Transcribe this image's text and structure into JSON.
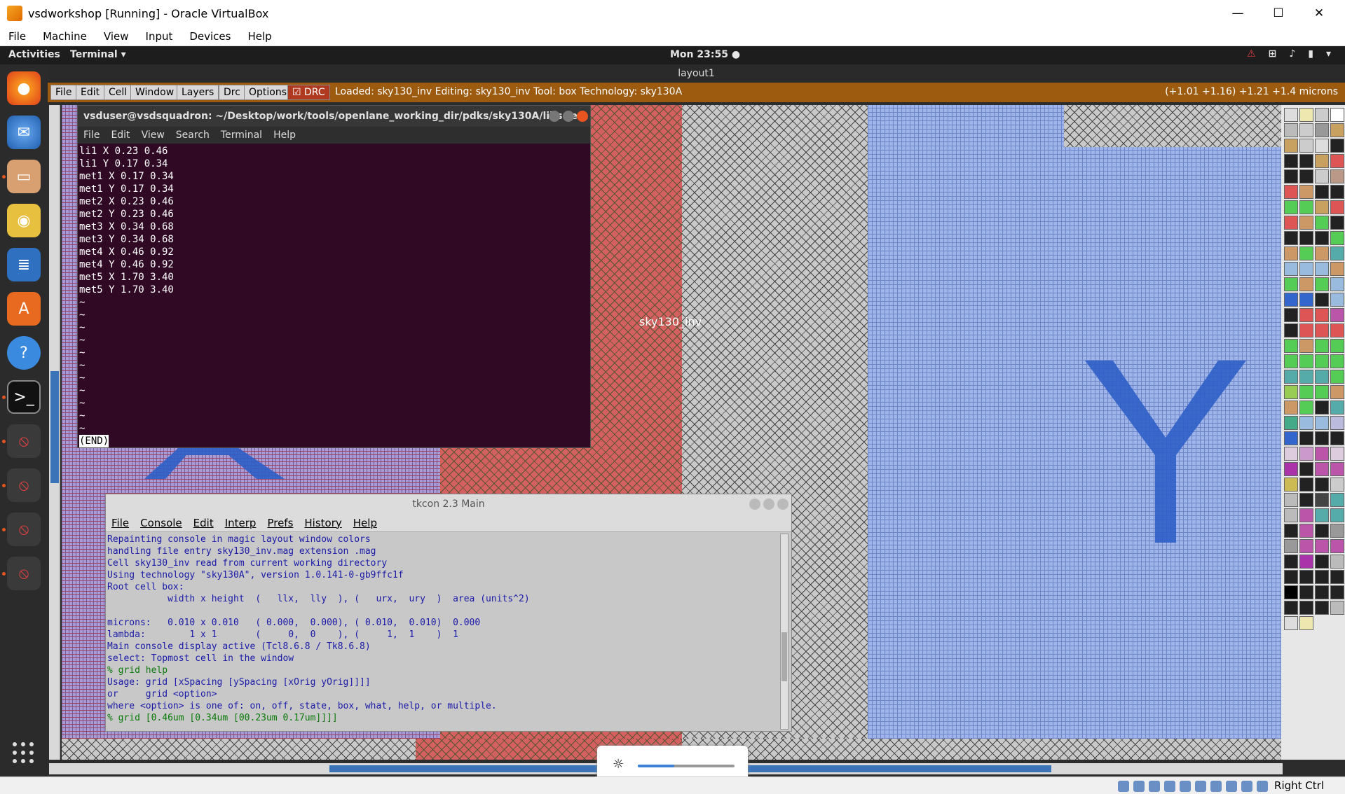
{
  "vbox": {
    "title": "vsdworkshop  [Running] - Oracle VirtualBox",
    "menu": [
      "File",
      "Machine",
      "View",
      "Input",
      "Devices",
      "Help"
    ],
    "status_right": "Right Ctrl"
  },
  "topbar": {
    "activities": "Activities",
    "app": "Terminal ▾",
    "clock": "Mon 23:55 ●"
  },
  "magic": {
    "window_title": "layout1",
    "menu": [
      "File",
      "Edit",
      "Cell",
      "Window",
      "Layers",
      "Drc",
      "Options"
    ],
    "drc_label": "DRC",
    "status": "Loaded: sky130_inv Editing: sky130_inv Tool: box  Technology: sky130A",
    "coords": "(+1.01 +1.16) +1.21 +1.4 microns",
    "cell_label": "sky130_inv",
    "label_y": "Y",
    "label_a": "A"
  },
  "terminal": {
    "title": "vsduser@vsdsquadron: ~/Desktop/work/tools/openlane_working_dir/pdks/sky130A/libs.te...",
    "menu": [
      "File",
      "Edit",
      "View",
      "Search",
      "Terminal",
      "Help"
    ],
    "lines": "li1 X 0.23 0.46\nli1 Y 0.17 0.34\nmet1 X 0.17 0.34\nmet1 Y 0.17 0.34\nmet2 X 0.23 0.46\nmet2 Y 0.23 0.46\nmet3 X 0.34 0.68\nmet3 Y 0.34 0.68\nmet4 X 0.46 0.92\nmet4 Y 0.46 0.92\nmet5 X 1.70 3.40\nmet5 Y 1.70 3.40\n~\n~\n~\n~\n~\n~\n~\n~\n~\n~\n~\n",
    "end_marker": "(END)"
  },
  "tkcon": {
    "title": "tkcon 2.3 Main",
    "menu": [
      "File",
      "Console",
      "Edit",
      "Interp",
      "Prefs",
      "History",
      "Help"
    ],
    "lines": [
      {
        "t": "Repainting console in magic layout window colors",
        "p": false
      },
      {
        "t": "handling file entry sky130_inv.mag extension .mag",
        "p": false
      },
      {
        "t": "Cell sky130_inv read from current working directory",
        "p": false
      },
      {
        "t": "Using technology \"sky130A\", version 1.0.141-0-gb9ffc1f",
        "p": false
      },
      {
        "t": "Root cell box:",
        "p": false
      },
      {
        "t": "           width x height  (   llx,  lly  ), (   urx,  ury  )  area (units^2)",
        "p": false
      },
      {
        "t": "",
        "p": false
      },
      {
        "t": "microns:   0.010 x 0.010   ( 0.000,  0.000), ( 0.010,  0.010)  0.000",
        "p": false
      },
      {
        "t": "lambda:        1 x 1       (     0,  0    ), (     1,  1    )  1",
        "p": false
      },
      {
        "t": "Main console display active (Tcl8.6.8 / Tk8.6.8)",
        "p": false
      },
      {
        "t": "select: Topmost cell in the window",
        "p": false
      },
      {
        "t": "% grid help",
        "p": true
      },
      {
        "t": "Usage: grid [xSpacing [ySpacing [xOrig yOrig]]]]",
        "p": false
      },
      {
        "t": "or     grid <option>",
        "p": false
      },
      {
        "t": "where <option> is one of: on, off, state, box, what, help, or multiple.",
        "p": false
      },
      {
        "t": "% grid [0.46um [0.34um [00.23um 0.17um]]]]",
        "p": true
      }
    ]
  },
  "brightness": {
    "level": 0.38,
    "icon": "sun-icon"
  },
  "colors": {
    "magic_bar": "#9c5b0f",
    "terminal_bg": "#300a24",
    "tkcon_text": "#1a1aa8",
    "ubuntu_accent": "#e95420"
  },
  "dock_icons": [
    "firefox-icon",
    "thunderbird-icon",
    "files-icon",
    "rhythmbox-icon",
    "writer-icon",
    "software-icon",
    "help-icon",
    "terminal-icon",
    "blocked-icon",
    "blocked-icon",
    "blocked-icon",
    "blocked-icon",
    "show-apps-icon"
  ]
}
